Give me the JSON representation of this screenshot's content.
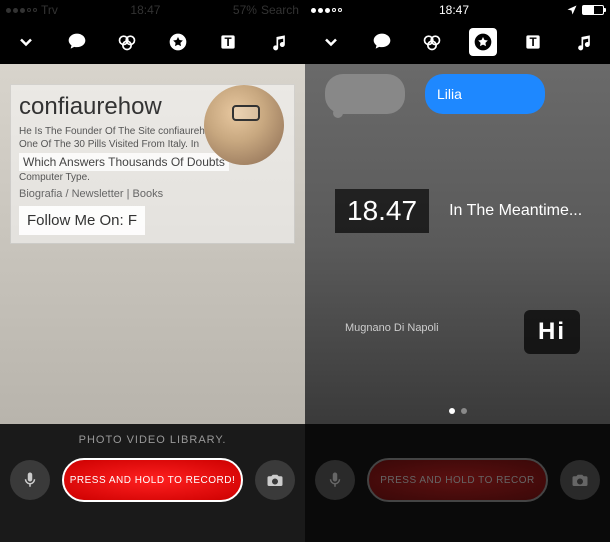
{
  "left": {
    "status": {
      "carrier": "Trv",
      "time": "18:47",
      "battery_pct": "57%",
      "search": "Search"
    },
    "profile": {
      "title": "confiaurehow",
      "desc1": "He Is The Founder Of The Site confiaurehow.com.",
      "desc2": "One Of The 30 Pills Visited From Italy. In",
      "highlight": "Which Answers Thousands Of Doubts",
      "type": "Computer Type.",
      "links": "Biografia / Newsletter | Books",
      "follow": "Follow Me On: F"
    },
    "bottom": {
      "library": "PHOTO VIDEO LIBRARY.",
      "record": "PRESS AND HOLD TO RECORD!"
    }
  },
  "right": {
    "status": {
      "time": "18:47"
    },
    "chat": {
      "blue_text": "Lilia"
    },
    "overlay": {
      "time": "18.47",
      "meantime": "In The Meantime...",
      "location": "Mugnano Di Napoli",
      "hi": "Hi"
    },
    "bottom": {
      "record": "PRESS AND HOLD TO RECOR"
    }
  }
}
